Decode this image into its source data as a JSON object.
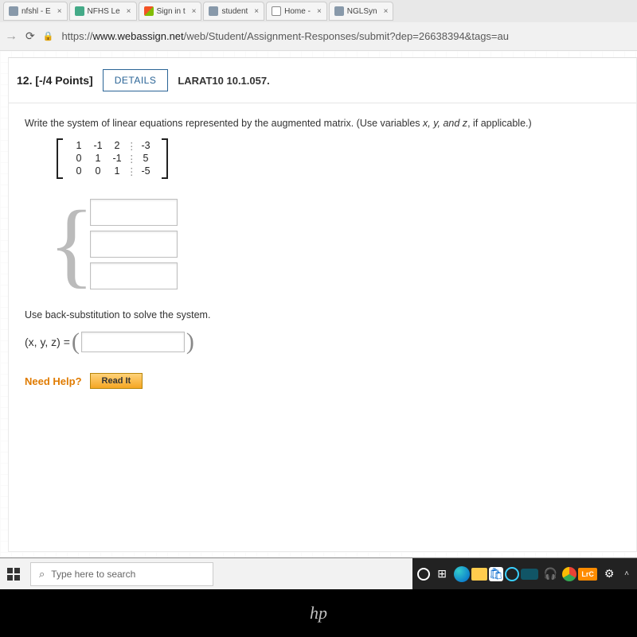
{
  "browser": {
    "tabs": [
      {
        "title": "nfshl - E",
        "favicon": "blue"
      },
      {
        "title": "NFHS Le",
        "favicon": "green"
      },
      {
        "title": "Sign in t",
        "favicon": "ms"
      },
      {
        "title": "student",
        "favicon": "blue"
      },
      {
        "title": "Home -",
        "favicon": "docs"
      },
      {
        "title": "NGLSyn",
        "favicon": "blue"
      }
    ],
    "url_prefix": "https://",
    "url_domain": "www.webassign.net",
    "url_path": "/web/Student/Assignment-Responses/submit?dep=26638394&tags=au"
  },
  "question": {
    "number": "12.",
    "points": "[-/4 Points]",
    "details_label": "DETAILS",
    "book_ref": "LARAT10 10.1.057.",
    "prompt_text": "Write the system of linear equations represented by the augmented matrix. (Use variables ",
    "prompt_vars": "x, y, and z",
    "prompt_tail": ", if applicable.)",
    "matrix": {
      "r1": [
        "1",
        "-1",
        "2",
        "⋮",
        "-3"
      ],
      "r2": [
        "0",
        "1",
        "-1",
        "⋮",
        "5"
      ],
      "r3": [
        "0",
        "0",
        "1",
        "⋮",
        "-5"
      ]
    },
    "instr2": "Use back-substitution to solve the system.",
    "tuple_label": "(x, y, z) = ",
    "need_help_label": "Need Help?",
    "read_it_label": "Read It"
  },
  "taskbar": {
    "search_placeholder": "Type here to search",
    "lrc_label": "LrC"
  },
  "bezel": {
    "logo": "hp"
  }
}
